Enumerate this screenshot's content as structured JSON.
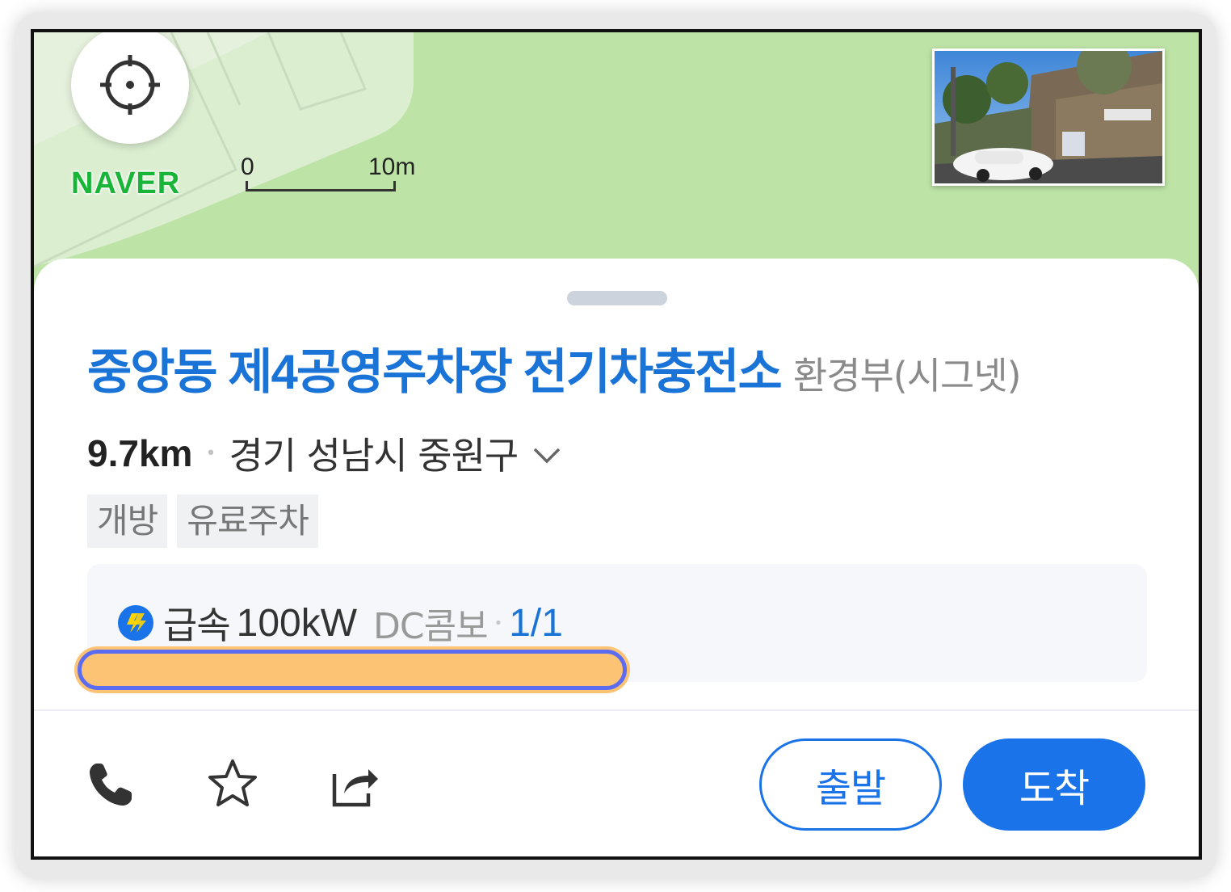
{
  "map": {
    "logo": "NAVER",
    "scale": {
      "start_label": "0",
      "end_label": "10m"
    },
    "icons": {
      "locate": "crosshair-icon",
      "thumbnail": "street-view-thumbnail"
    }
  },
  "place": {
    "name": "중앙동 제4공영주차장 전기차충전소",
    "category": "환경부(시그넷)",
    "distance": "9.7km",
    "address": "경기 성남시 중원구",
    "tags": [
      "개방",
      "유료주차"
    ]
  },
  "charger": {
    "type": "급속",
    "power": "100kW",
    "connector": "DC콤보",
    "availability": "1/1"
  },
  "actions": {
    "icons": [
      "phone-icon",
      "star-icon",
      "share-icon"
    ],
    "depart_label": "출발",
    "arrive_label": "도착"
  },
  "colors": {
    "primary": "#1a73e8",
    "title": "#1a73d6",
    "map_green": "#bde3a6",
    "naver_green": "#19b539",
    "highlight_fill": "#fdc374",
    "highlight_border": "#5b6cf0"
  }
}
